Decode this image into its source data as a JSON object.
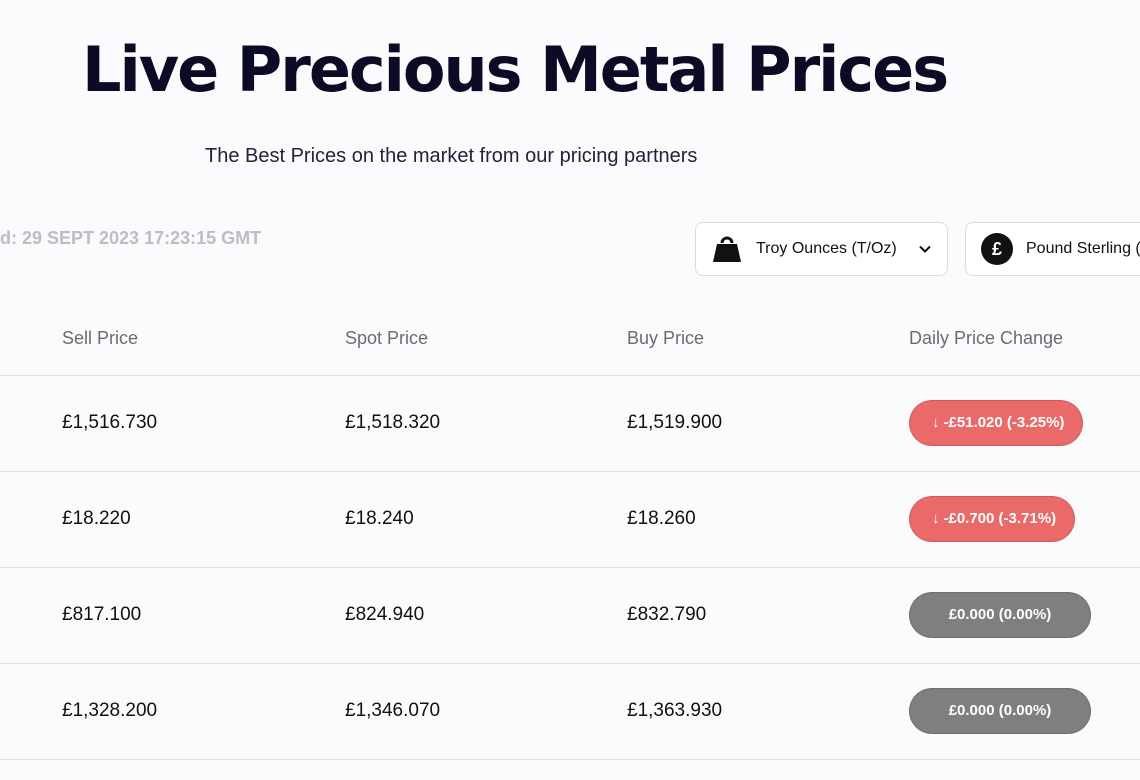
{
  "header": {
    "title": "Live Precious Metal Prices",
    "subtitle": "The Best Prices on the market from our pricing partners",
    "updated_text": "d: 29 SEPT 2023 17:23:15 GMT"
  },
  "controls": {
    "weight_unit": {
      "label": "Troy Ounces (T/Oz)",
      "icon": "weight-icon"
    },
    "currency": {
      "label": "Pound Sterling (",
      "icon": "pound-icon",
      "icon_glyph": "£"
    }
  },
  "table": {
    "columns": [
      "Sell Price",
      "Spot Price",
      "Buy Price",
      "Daily Price Change"
    ],
    "rows": [
      {
        "sell": "£1,516.730",
        "spot": "£1,518.320",
        "buy": "£1,519.900",
        "change": "-£51.020 (-3.25%)",
        "direction": "down",
        "arrow": "↓"
      },
      {
        "sell": "£18.220",
        "spot": "£18.240",
        "buy": "£18.260",
        "change": "-£0.700 (-3.71%)",
        "direction": "down",
        "arrow": "↓"
      },
      {
        "sell": "£817.100",
        "spot": "£824.940",
        "buy": "£832.790",
        "change": "£0.000 (0.00%)",
        "direction": "flat",
        "arrow": ""
      },
      {
        "sell": "£1,328.200",
        "spot": "£1,346.070",
        "buy": "£1,363.930",
        "change": "£0.000 (0.00%)",
        "direction": "flat",
        "arrow": ""
      }
    ]
  },
  "colors": {
    "down": "#ea6a6a",
    "flat": "#7f7f7f",
    "title": "#0b0b26",
    "background": "#fbfbfd"
  }
}
